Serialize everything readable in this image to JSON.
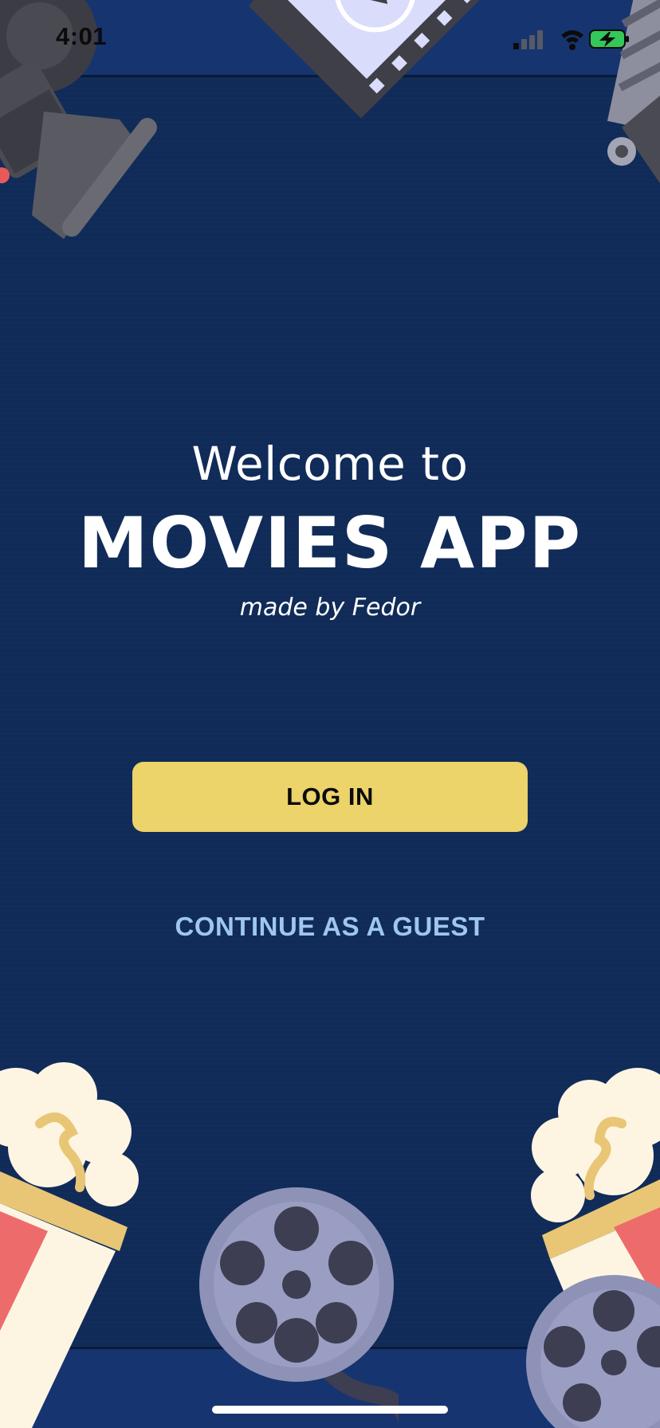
{
  "status_bar": {
    "time": "4:01"
  },
  "welcome": {
    "line1": "Welcome to",
    "title": "MOVIES APP",
    "subtitle": "made by Fedor"
  },
  "actions": {
    "login_label": "LOG IN",
    "guest_label": "CONTINUE AS A GUEST"
  },
  "colors": {
    "background": "#102b58",
    "accent_button": "#ecd36a",
    "guest_link": "#9fc6f0",
    "battery": "#34c759"
  },
  "icons": {
    "decor": [
      "movie-camera-icon",
      "film-frame-icon",
      "clapperboard-icon",
      "popcorn-icon",
      "film-reel-icon"
    ],
    "status": [
      "cellular-signal-icon",
      "wifi-icon",
      "battery-charging-icon"
    ]
  }
}
